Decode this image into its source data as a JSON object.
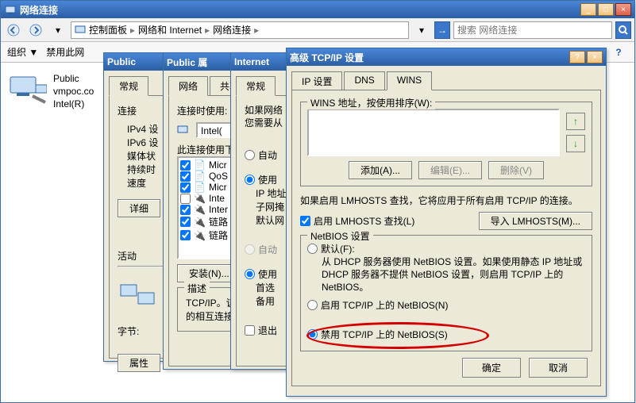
{
  "mainWindow": {
    "title": "网络连接",
    "breadcrumb": {
      "root": "控制面板",
      "mid": "网络和 Internet",
      "leaf": "网络连接"
    },
    "searchPlaceholder": "搜索 网络连接",
    "menu": {
      "org": "组织 ▼",
      "disable": "禁用此网"
    }
  },
  "nic": {
    "name": "Public",
    "line2": "vmpoc.co",
    "line3": "Intel(R)"
  },
  "win1": {
    "title": "Public",
    "tab": "常规",
    "lbl_connect": "连接",
    "lbl_ipv4": "IPv4 设",
    "lbl_ipv6": "IPv6 设",
    "lbl_media": "媒体状",
    "lbl_duration": "持续时",
    "lbl_speed": "速度",
    "btn_detail": "详细",
    "lbl_activity": "活动",
    "lbl_bytes": "字节:",
    "btn_prop": "属性"
  },
  "win2": {
    "title": "Public 属",
    "tab1": "网络",
    "tab2": "共享",
    "lbl_connuse": "连接时使用:",
    "device": "Intel(",
    "lbl_thisconn": "此连接使用下",
    "items": [
      "Micr",
      "QoS",
      "Micr",
      "Inte",
      "Inter",
      "链路",
      "链路"
    ],
    "btn_install": "安装(N)...",
    "lbl_desc": "描述",
    "desc1": "TCP/IP。该",
    "desc2": "的相互连接"
  },
  "win3": {
    "title": "Internet",
    "tab": "常规",
    "help1": "如果网络",
    "help2": "您需要从",
    "r_auto": "自动",
    "r_use": "使用",
    "lbl_ip": "IP 地址",
    "lbl_subnet": "子网掩",
    "lbl_gw": "默认网",
    "r_auto2": "自动",
    "r_use2": "使用",
    "lbl_pref": "首选",
    "lbl_alt": "备用",
    "cb_exit": "退出"
  },
  "win4": {
    "title": "高级 TCP/IP 设置",
    "tabs": {
      "ip": "IP 设置",
      "dns": "DNS",
      "wins": "WINS"
    },
    "group_wins": "WINS 地址，按使用排序(W):",
    "btn_add": "添加(A)...",
    "btn_edit": "编辑(E)...",
    "btn_del": "删除(V)",
    "lmhosts_note": "如果启用 LMHOSTS 查找，它将应用于所有启用 TCP/IP 的连接。",
    "cb_lmhosts": "启用 LMHOSTS 查找(L)",
    "btn_import": "导入 LMHOSTS(M)...",
    "group_netbios": "NetBIOS 设置",
    "r_default": "默认(F):",
    "default_desc": "从 DHCP 服务器使用 NetBIOS 设置。如果使用静态 IP 地址或 DHCP 服务器不提供 NetBIOS 设置，则启用 TCP/IP 上的 NetBIOS。",
    "r_enable": "启用 TCP/IP 上的 NetBIOS(N)",
    "r_disable": "禁用 TCP/IP 上的 NetBIOS(S)",
    "btn_ok": "确定",
    "btn_cancel": "取消"
  }
}
